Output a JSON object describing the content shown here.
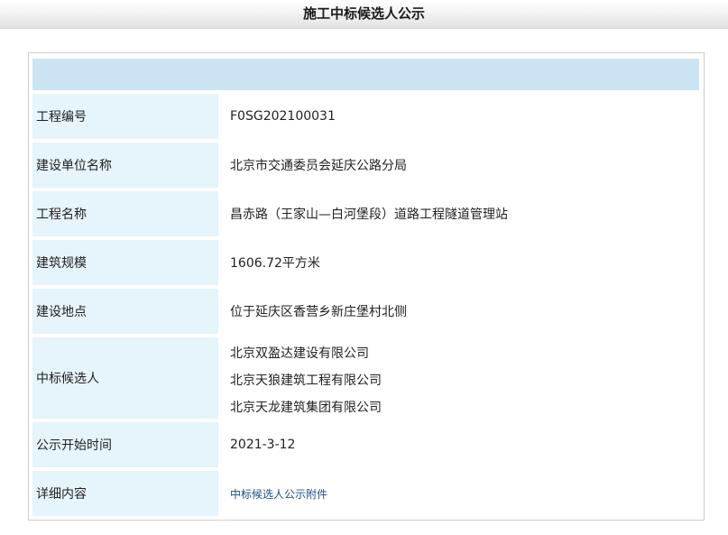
{
  "page": {
    "title": "施工中标候选人公示"
  },
  "rows": [
    {
      "label": "工程编号",
      "value": "F0SG202100031"
    },
    {
      "label": "建设单位名称",
      "value": "北京市交通委员会延庆公路分局"
    },
    {
      "label": "工程名称",
      "value": "昌赤路（王家山—白河堡段）道路工程隧道管理站"
    },
    {
      "label": "建筑规模",
      "value": "1606.72平方米"
    },
    {
      "label": "建设地点",
      "value": "位于延庆区香营乡新庄堡村北侧"
    },
    {
      "label": "中标候选人",
      "values": [
        "北京双盈达建设有限公司",
        "北京天狼建筑工程有限公司",
        "北京天龙建筑集团有限公司"
      ]
    },
    {
      "label": "公示开始时间",
      "value": "2021-3-12"
    },
    {
      "label": "详细内容",
      "link_text": "中标候选人公示附件"
    }
  ]
}
